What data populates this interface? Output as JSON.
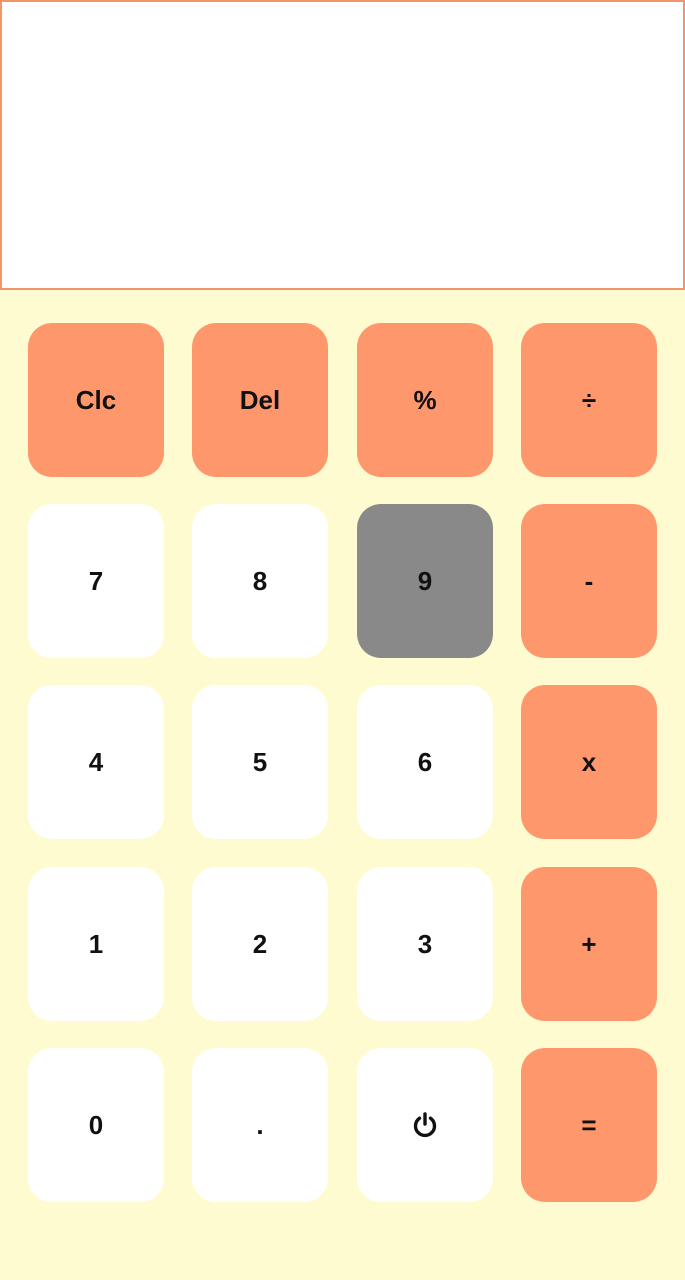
{
  "display": {
    "value": ""
  },
  "colors": {
    "background": "#FFFBD1",
    "display_background": "#FFFFFF",
    "display_border": "#F2956B",
    "accent_key": "#FF976D",
    "number_key": "#FFFFFF",
    "pressed_key": "#898989"
  },
  "keys": {
    "clear": "Clc",
    "delete": "Del",
    "percent": "%",
    "divide": "÷",
    "seven": "7",
    "eight": "8",
    "nine": "9",
    "minus": "-",
    "four": "4",
    "five": "5",
    "six": "6",
    "multiply": "x",
    "one": "1",
    "two": "2",
    "three": "3",
    "plus": "+",
    "zero": "0",
    "decimal": ".",
    "power_icon": "power-icon",
    "equals": "="
  }
}
